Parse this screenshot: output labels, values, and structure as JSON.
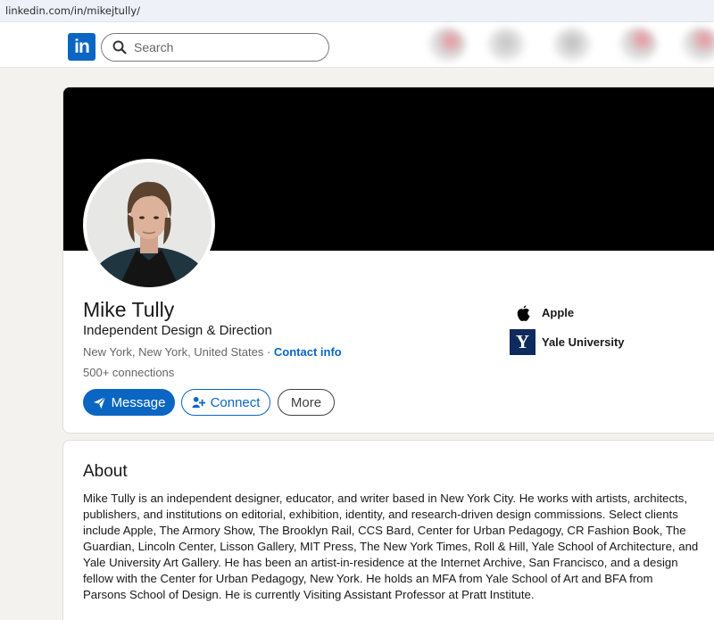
{
  "browser": {
    "url": "linkedin.com/in/mikejtully/"
  },
  "nav": {
    "logo_text": "in",
    "search_placeholder": "Search"
  },
  "profile": {
    "name": "Mike Tully",
    "headline": "Independent Design & Direction",
    "location": "New York, New York, United States",
    "separator": " · ",
    "contact_info": "Contact info",
    "connections": "500+ connections",
    "buttons": {
      "message": "Message",
      "connect": "Connect",
      "more": "More"
    },
    "experience": [
      {
        "name": "Apple"
      },
      {
        "name": "Yale University",
        "logo_letter": "Y"
      }
    ]
  },
  "about": {
    "title": "About",
    "text": "Mike Tully is an independent designer, educator, and writer based in New York City. He works with artists, architects, publishers, and institutions on editorial, exhibition, identity, and research-driven design commissions. Select clients include Apple, The Armory Show, The Brooklyn Rail, CCS Bard, Center for Urban Pedagogy, CR Fashion Book, The Guardian, Lincoln Center, Lisson Gallery, MIT Press, The New York Times, Roll & Hill, Yale School of Architecture, and Yale University Art Gallery. He has been an artist-in-residence at the Internet Archive, San Francisco, and a design fellow with the Center for Urban Pedagogy, New York. He holds an MFA from Yale School of Art and BFA from Parsons School of Design. He is currently Visiting Assistant Professor at Pratt Institute."
  },
  "colors": {
    "brand": "#0a66c2",
    "banner": "#000000",
    "page_bg": "#f4f2ee",
    "yale_blue": "#0f2a5c"
  }
}
